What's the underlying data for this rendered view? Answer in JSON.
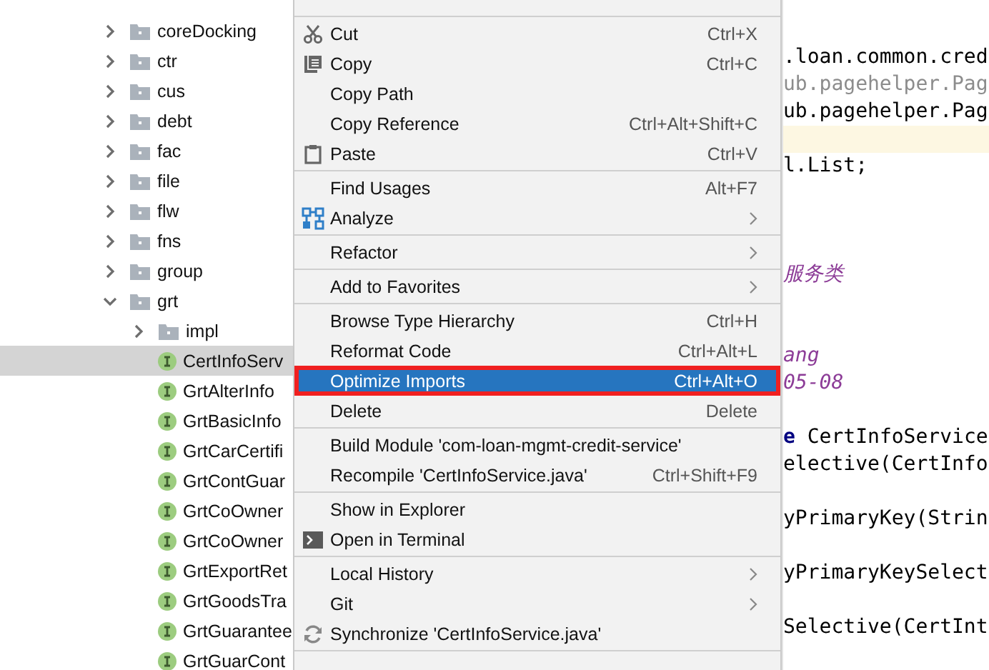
{
  "project_tree": [
    {
      "name": "coreDocking",
      "kind": "folder",
      "expanded": false,
      "selected": false
    },
    {
      "name": "ctr",
      "kind": "folder",
      "expanded": false,
      "selected": false
    },
    {
      "name": "cus",
      "kind": "folder",
      "expanded": false,
      "selected": false
    },
    {
      "name": "debt",
      "kind": "folder",
      "expanded": false,
      "selected": false
    },
    {
      "name": "fac",
      "kind": "folder",
      "expanded": false,
      "selected": false
    },
    {
      "name": "file",
      "kind": "folder",
      "expanded": false,
      "selected": false
    },
    {
      "name": "flw",
      "kind": "folder",
      "expanded": false,
      "selected": false
    },
    {
      "name": "fns",
      "kind": "folder",
      "expanded": false,
      "selected": false
    },
    {
      "name": "group",
      "kind": "folder",
      "expanded": false,
      "selected": false
    },
    {
      "name": "grt",
      "kind": "folder",
      "expanded": true,
      "selected": false,
      "children": [
        {
          "name": "impl",
          "kind": "folder",
          "expanded": false,
          "selected": false
        },
        {
          "name": "CertInfoServ",
          "kind": "interface",
          "selected": true
        },
        {
          "name": "GrtAlterInfo",
          "kind": "interface",
          "selected": false
        },
        {
          "name": "GrtBasicInfo",
          "kind": "interface",
          "selected": false
        },
        {
          "name": "GrtCarCertifi",
          "kind": "interface",
          "selected": false
        },
        {
          "name": "GrtContGuar",
          "kind": "interface",
          "selected": false
        },
        {
          "name": "GrtCoOwner",
          "kind": "interface",
          "selected": false
        },
        {
          "name": "GrtCoOwner",
          "kind": "interface",
          "selected": false
        },
        {
          "name": "GrtExportRet",
          "kind": "interface",
          "selected": false
        },
        {
          "name": "GrtGoodsTra",
          "kind": "interface",
          "selected": false
        },
        {
          "name": "GrtGuarantee",
          "kind": "interface",
          "selected": false
        },
        {
          "name": "GrtGuarCont",
          "kind": "interface",
          "selected": false
        }
      ]
    }
  ],
  "context_menu": {
    "groups": [
      [
        {
          "label": "Cut",
          "shortcut": "Ctrl+X",
          "selected": false
        },
        {
          "label": "Copy",
          "shortcut": "Ctrl+C",
          "selected": false
        },
        {
          "label": "Copy Path",
          "selected": false
        },
        {
          "label": "Copy Reference",
          "shortcut": "Ctrl+Alt+Shift+C",
          "selected": false
        },
        {
          "label": "Paste",
          "shortcut": "Ctrl+V",
          "selected": false
        }
      ],
      [
        {
          "label": "Find Usages",
          "shortcut": "Alt+F7",
          "selected": false
        },
        {
          "label": "Analyze",
          "submenu": true,
          "selected": false
        }
      ],
      [
        {
          "label": "Refactor",
          "submenu": true,
          "selected": false
        }
      ],
      [
        {
          "label": "Add to Favorites",
          "submenu": true,
          "selected": false
        }
      ],
      [
        {
          "label": "Browse Type Hierarchy",
          "shortcut": "Ctrl+H",
          "selected": false
        },
        {
          "label": "Reformat Code",
          "shortcut": "Ctrl+Alt+L",
          "selected": false
        },
        {
          "label": "Optimize Imports",
          "shortcut": "Ctrl+Alt+O",
          "selected": true,
          "annotated": true
        },
        {
          "label": "Delete",
          "shortcut": "Delete",
          "selected": false,
          "annotated": false
        }
      ],
      [
        {
          "label": "Build Module 'com-loan-mgmt-credit-service'",
          "selected": false
        },
        {
          "label": "Recompile 'CertInfoService.java'",
          "shortcut": "Ctrl+Shift+F9",
          "selected": false
        }
      ],
      [
        {
          "label": "Show in Explorer",
          "selected": false
        },
        {
          "label": "Open in Terminal",
          "selected": false
        }
      ],
      [
        {
          "label": "Local History",
          "submenu": true,
          "selected": false
        },
        {
          "label": "Git",
          "submenu": true,
          "selected": false
        },
        {
          "label": "Synchronize 'CertInfoService.java'",
          "selected": false
        }
      ]
    ]
  },
  "editor_lines": [
    {
      "kind": "blank"
    },
    {
      "kind": "blank"
    },
    {
      "kind": "code",
      "text": ".loan.common.cred"
    },
    {
      "kind": "muted",
      "text": "ub.pagehelper.Pag"
    },
    {
      "kind": "code",
      "text": "ub.pagehelper.Pag"
    },
    {
      "kind": "current"
    },
    {
      "kind": "code",
      "text": "l.List;"
    },
    {
      "kind": "blank"
    },
    {
      "kind": "blank"
    },
    {
      "kind": "blank"
    },
    {
      "kind": "comment",
      "text": "服务类"
    },
    {
      "kind": "blank"
    },
    {
      "kind": "blank"
    },
    {
      "kind": "comment",
      "text": "ang"
    },
    {
      "kind": "comment",
      "text": "05-08"
    },
    {
      "kind": "blank"
    },
    {
      "kind": "code",
      "text": "**e** CertInfoService"
    },
    {
      "kind": "code",
      "text": "elective(CertInfo"
    },
    {
      "kind": "blank"
    },
    {
      "kind": "code",
      "text": "yPrimaryKey(Strin"
    },
    {
      "kind": "blank"
    },
    {
      "kind": "code",
      "text": "yPrimaryKeySelect"
    },
    {
      "kind": "blank"
    },
    {
      "kind": "code",
      "text": "Selective(CertInt"
    }
  ]
}
